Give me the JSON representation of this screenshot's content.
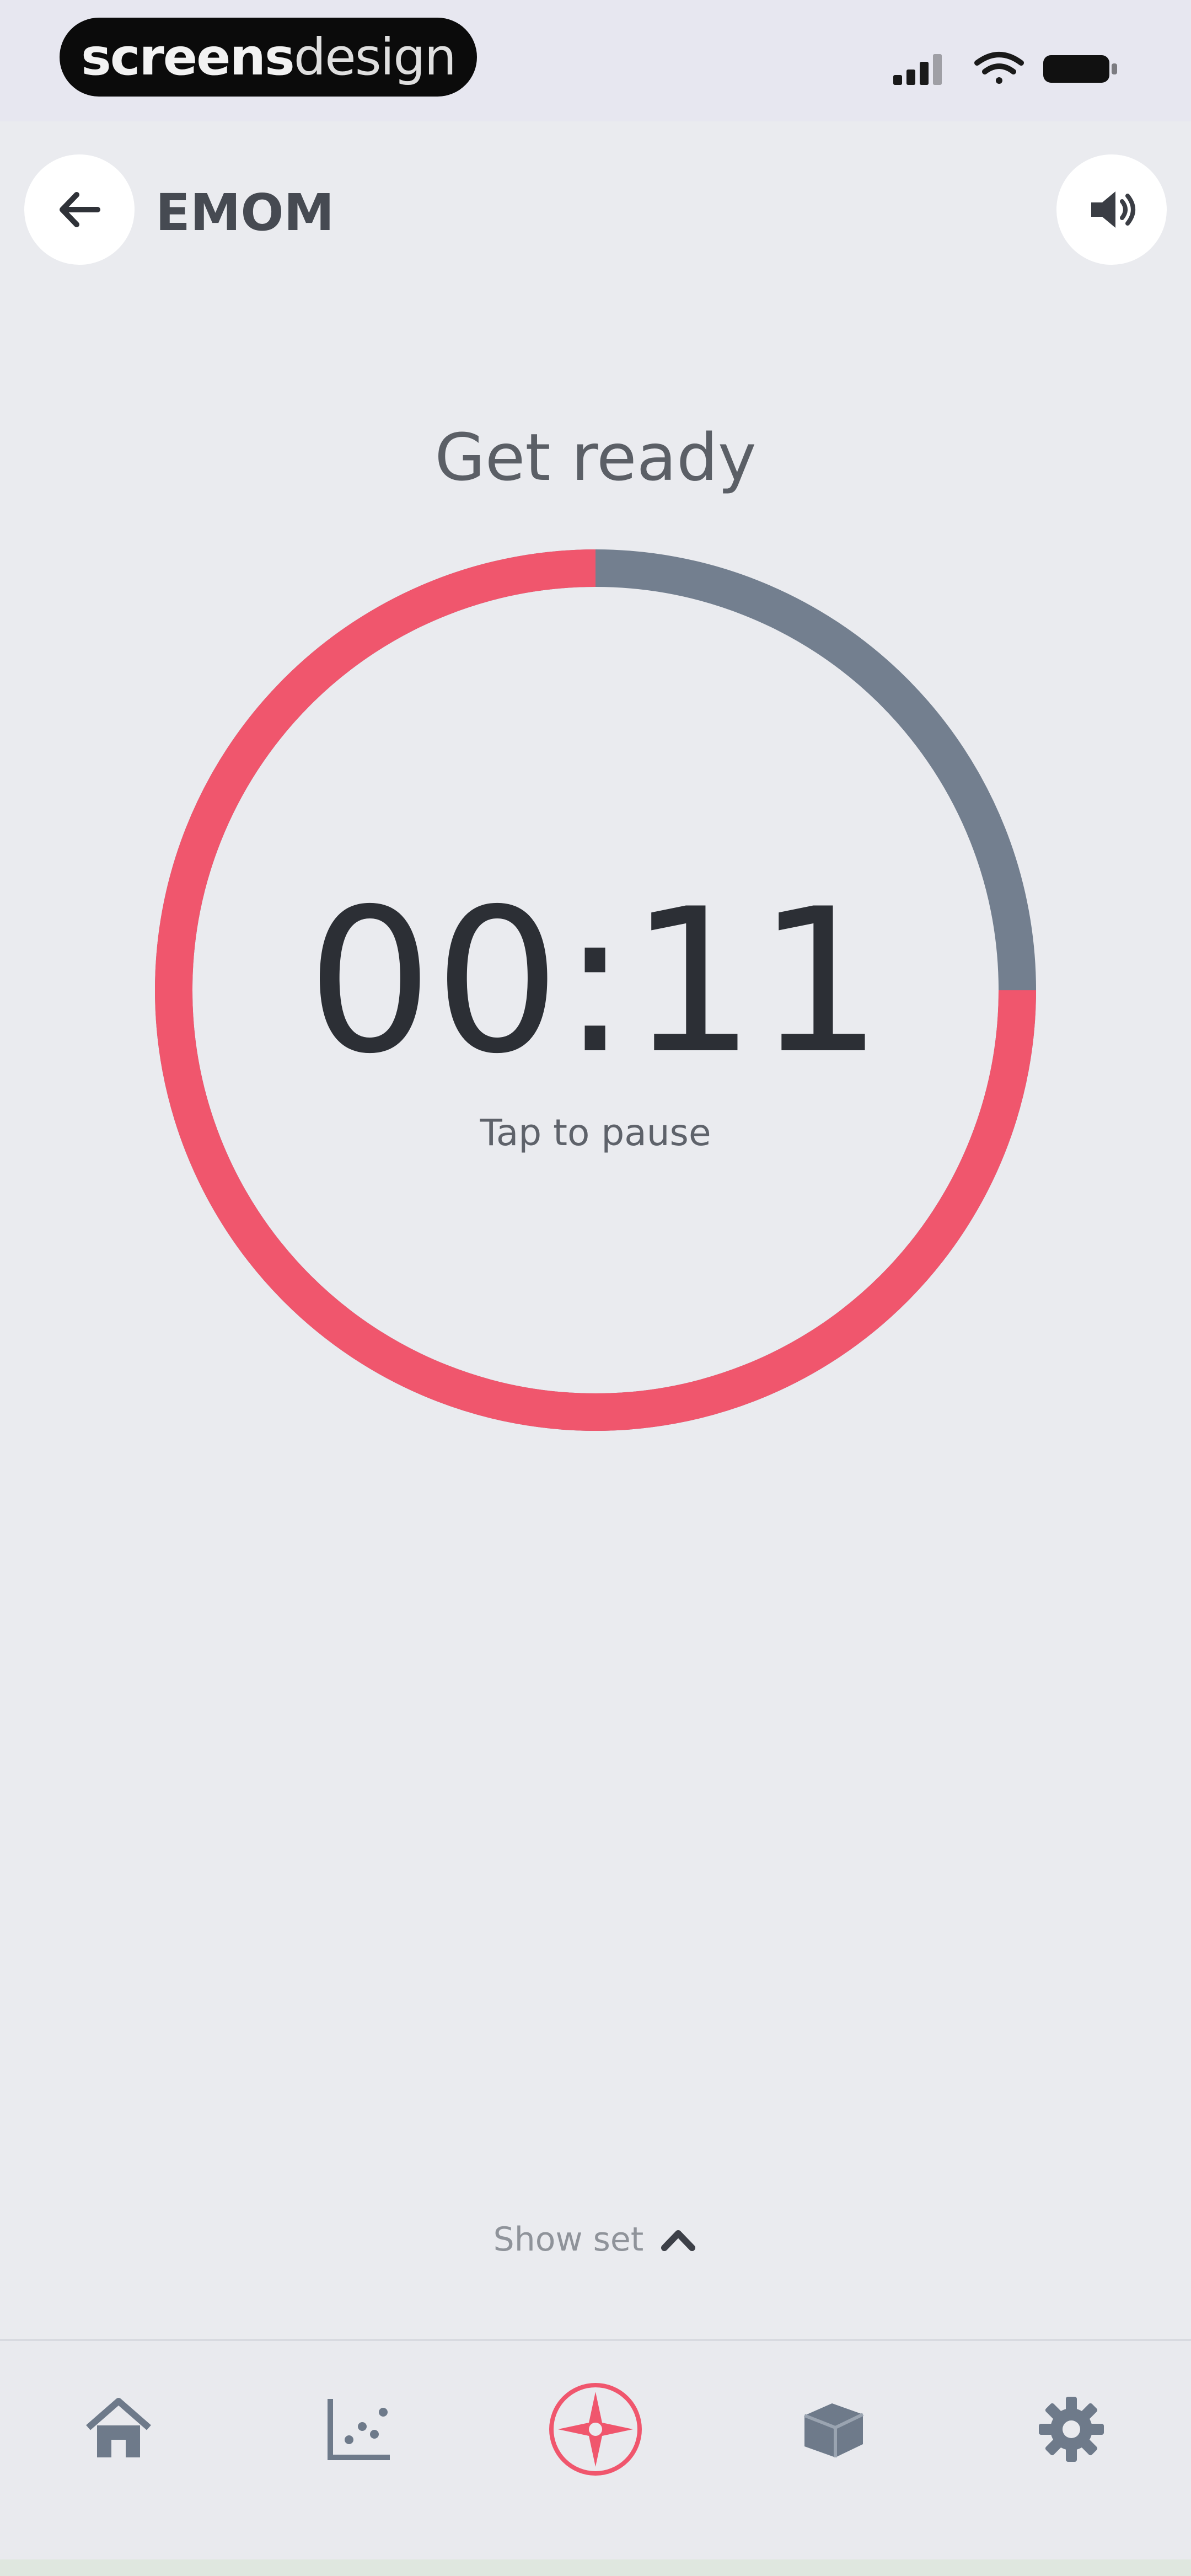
{
  "status_bar": {
    "brand_bold": "screens",
    "brand_light": "design",
    "icons": [
      "signal-icon",
      "wifi-icon",
      "battery-icon"
    ]
  },
  "header": {
    "title": "EMOM",
    "back_icon": "arrow-left-icon",
    "sound_icon": "speaker-icon"
  },
  "timer": {
    "status": "Get ready",
    "time": "00:11",
    "hint": "Tap to pause",
    "progress_remaining": 0.75,
    "colors": {
      "remaining": "#f0566d",
      "elapsed": "#737f8f"
    }
  },
  "show_set": {
    "label": "Show set",
    "icon": "chevron-up-icon"
  },
  "bottom_nav": {
    "items": [
      {
        "name": "home",
        "icon": "home-icon",
        "active": false
      },
      {
        "name": "stats",
        "icon": "chart-icon",
        "active": false
      },
      {
        "name": "timer",
        "icon": "compass-icon",
        "active": true
      },
      {
        "name": "box",
        "icon": "box-icon",
        "active": false
      },
      {
        "name": "settings",
        "icon": "gear-icon",
        "active": false
      }
    ],
    "colors": {
      "active": "#f0566d",
      "inactive": "#6e7a8a"
    }
  }
}
